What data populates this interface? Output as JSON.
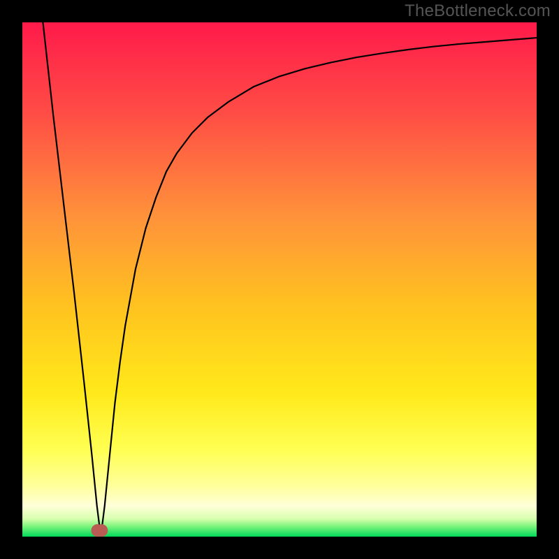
{
  "watermark": "TheBottleneck.com",
  "chart_data": {
    "type": "line",
    "title": "",
    "xlabel": "",
    "ylabel": "",
    "xlim": [
      0,
      100
    ],
    "ylim": [
      0,
      100
    ],
    "grid": false,
    "series": [
      {
        "name": "black-curve",
        "x": [
          4,
          6,
          8,
          10,
          12,
          13.5,
          14.5,
          15,
          15.5,
          16,
          17,
          18,
          19,
          20,
          22,
          24,
          26,
          28,
          30,
          33,
          36,
          40,
          45,
          50,
          55,
          60,
          65,
          70,
          75,
          80,
          85,
          90,
          95,
          100
        ],
        "y": [
          100,
          82,
          65,
          48,
          30,
          16,
          6,
          2,
          2,
          6,
          16,
          26,
          34,
          41,
          52,
          60,
          66,
          71,
          74.5,
          78.5,
          81.5,
          84.5,
          87.5,
          89.5,
          91,
          92.2,
          93.2,
          94,
          94.7,
          95.3,
          95.8,
          96.2,
          96.6,
          97
        ]
      },
      {
        "name": "marker-cluster",
        "type": "scatter",
        "color": "#b95d54",
        "points": [
          {
            "x": 14.6,
            "y": 1.2
          },
          {
            "x": 15.4,
            "y": 1.2
          }
        ]
      }
    ],
    "background_gradient": {
      "top": "#ff1a4b",
      "upper_mid": "#ff6a3a",
      "mid": "#ffd21f",
      "lower_mid": "#ffff66",
      "pale_band": "#ffffb0",
      "base": "#00e05a"
    }
  }
}
